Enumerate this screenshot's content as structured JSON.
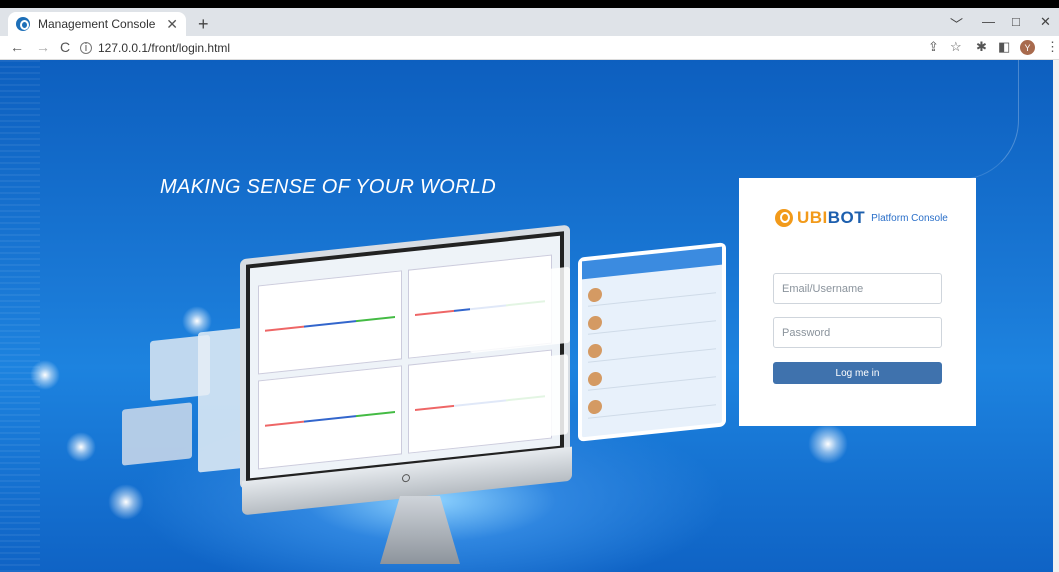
{
  "browser": {
    "tab_title": "Management Console",
    "tab_close": "✕",
    "new_tab": "+",
    "url": "127.0.0.1/front/login.html",
    "win_controls": [
      "﹀",
      "—",
      "□",
      "✕"
    ],
    "nav": {
      "back": "←",
      "forward": "→",
      "reload": "C"
    },
    "avatar_letter": "Y"
  },
  "hero": {
    "headline": "MAKING SENSE OF YOUR WORLD"
  },
  "login": {
    "brand_ubi": "UBI",
    "brand_bot": "BOT",
    "brand_sub": "Platform Console",
    "email_placeholder": "Email/Username",
    "password_placeholder": "Password",
    "submit_label": "Log me in"
  },
  "colors": {
    "brand_orange": "#f29a1a",
    "brand_blue": "#1d5fae",
    "button": "#3f72ad"
  }
}
